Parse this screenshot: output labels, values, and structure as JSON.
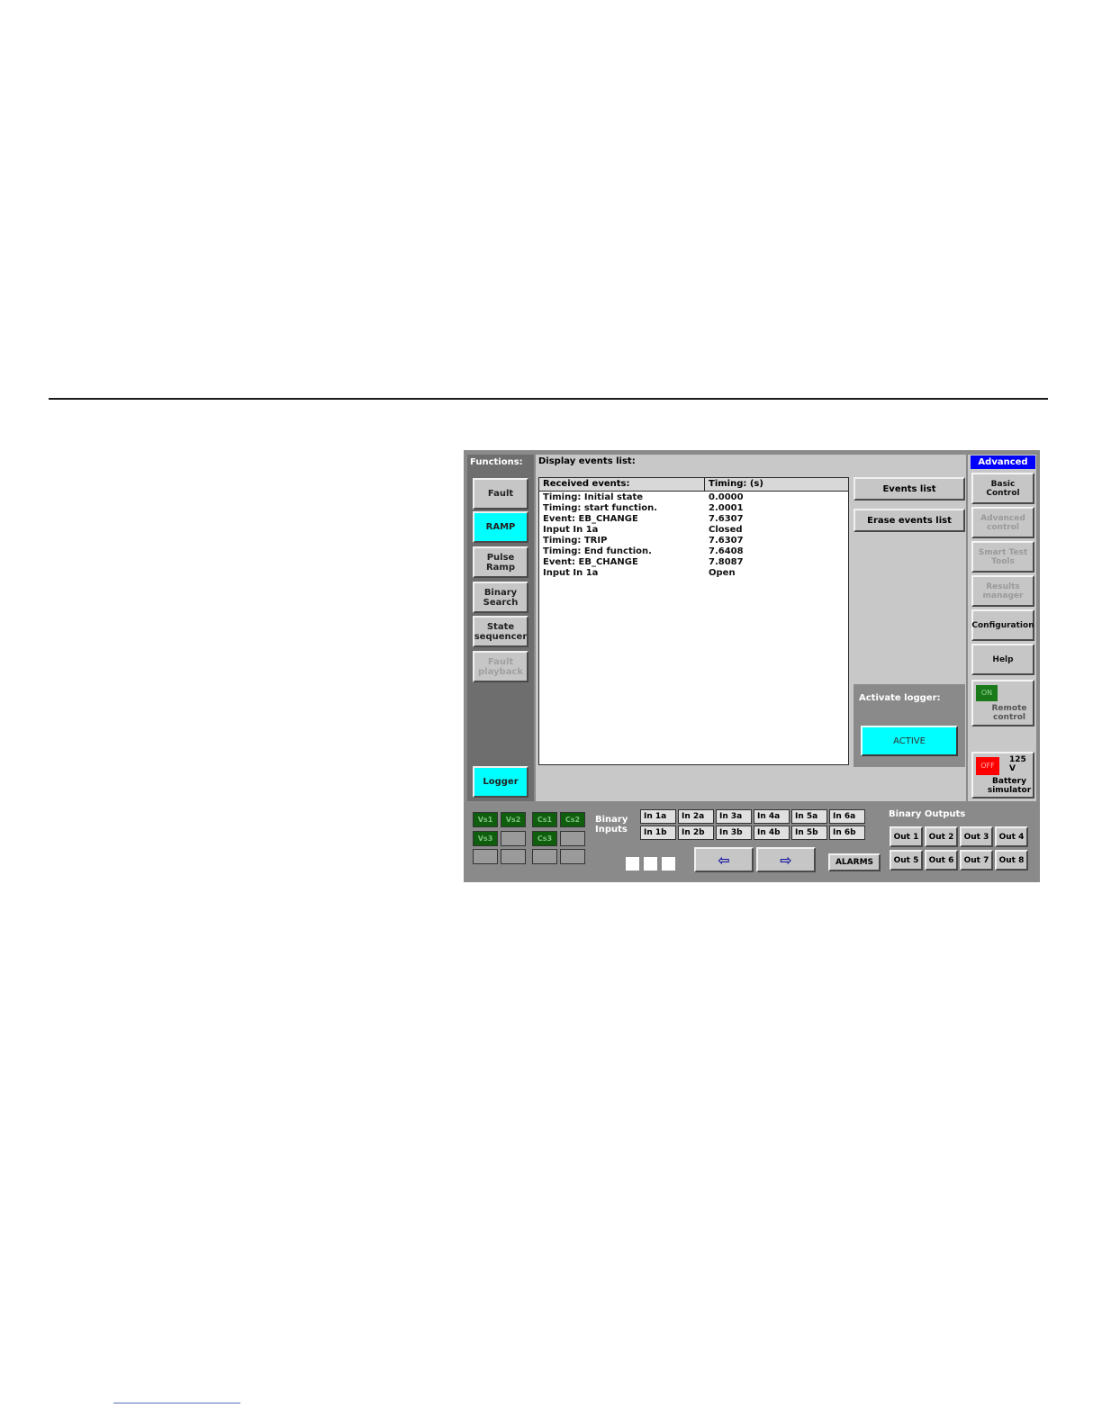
{
  "functions": {
    "title": "Functions:",
    "items": [
      {
        "label": "Fault",
        "state": "normal"
      },
      {
        "label": "RAMP",
        "state": "selected"
      },
      {
        "label": "Pulse\nRamp",
        "state": "normal"
      },
      {
        "label": "Binary\nSearch",
        "state": "normal"
      },
      {
        "label": "State\nsequencer",
        "state": "normal"
      },
      {
        "label": "Fault\nplayback",
        "state": "disabled"
      }
    ],
    "logger_label": "Logger"
  },
  "display": {
    "title": "Display events list:",
    "columns": [
      "Received events:",
      "Timing: (s)"
    ],
    "rows": [
      [
        "Timing: Initial state",
        "0.0000"
      ],
      [
        "Timing: start function.",
        "2.0001"
      ],
      [
        "Event: EB_CHANGE",
        "7.6307"
      ],
      [
        "Input In 1a",
        "Closed"
      ],
      [
        "Timing: TRIP",
        "7.6307"
      ],
      [
        "Timing: End function.",
        "7.6408"
      ],
      [
        "Event: EB_CHANGE",
        "7.8087"
      ],
      [
        "Input In 1a",
        "Open"
      ]
    ],
    "events_list_label": "Events list",
    "erase_label": "Erase events list",
    "activate_logger_label": "Activate logger:",
    "active_label": "ACTIVE"
  },
  "mode": {
    "title": "Advanced",
    "buttons": [
      {
        "label": "Basic\nControl",
        "state": "normal"
      },
      {
        "label": "Advanced\ncontrol",
        "state": "disabled"
      },
      {
        "label": "Smart Test\nTools",
        "state": "disabled"
      },
      {
        "label": "Results\nmanager",
        "state": "disabled"
      },
      {
        "label": "Configuration",
        "state": "normal"
      },
      {
        "label": "Help",
        "state": "normal"
      }
    ],
    "remote_on": "ON",
    "remote_label": "Remote\ncontrol",
    "battery_off": "OFF",
    "battery_voltage": "125 V",
    "battery_label": "Battery\nsimulator"
  },
  "status_lamps": [
    {
      "label": "Vs1",
      "active": true
    },
    {
      "label": "Vs2",
      "active": true
    },
    {
      "label": "Cs1",
      "active": true
    },
    {
      "label": "Cs2",
      "active": true
    },
    {
      "label": "Vs3",
      "active": true
    },
    {
      "label": "",
      "active": false
    },
    {
      "label": "Cs3",
      "active": true
    },
    {
      "label": "",
      "active": false
    },
    {
      "label": "",
      "active": false
    },
    {
      "label": "",
      "active": false
    },
    {
      "label": "",
      "active": false
    },
    {
      "label": "",
      "active": false
    }
  ],
  "binary_inputs": {
    "label": "Binary\nInputs",
    "row_a": [
      "In 1a",
      "In 2a",
      "In 3a",
      "In 4a",
      "In 5a",
      "In 6a"
    ],
    "row_b": [
      "In 1b",
      "In 2b",
      "In 3b",
      "In 4b",
      "In 5b",
      "In 6b"
    ]
  },
  "binary_outputs": {
    "label": "Binary Outputs",
    "items": [
      "Out 1",
      "Out 2",
      "Out 3",
      "Out 4",
      "Out 5",
      "Out 6",
      "Out 7",
      "Out 8"
    ]
  },
  "nav": {
    "prev_icon": "left-arrow-icon",
    "next_icon": "right-arrow-icon",
    "prev_glyph": "⇦",
    "next_glyph": "⇨",
    "alarms_label": "ALARMS"
  },
  "colors": {
    "accent_cyan": "#00ffff",
    "mode_blue": "#0000ff",
    "lamp_green": "#0e5e0e",
    "on_green": "#1a7a1a",
    "off_red": "#ff0000"
  }
}
